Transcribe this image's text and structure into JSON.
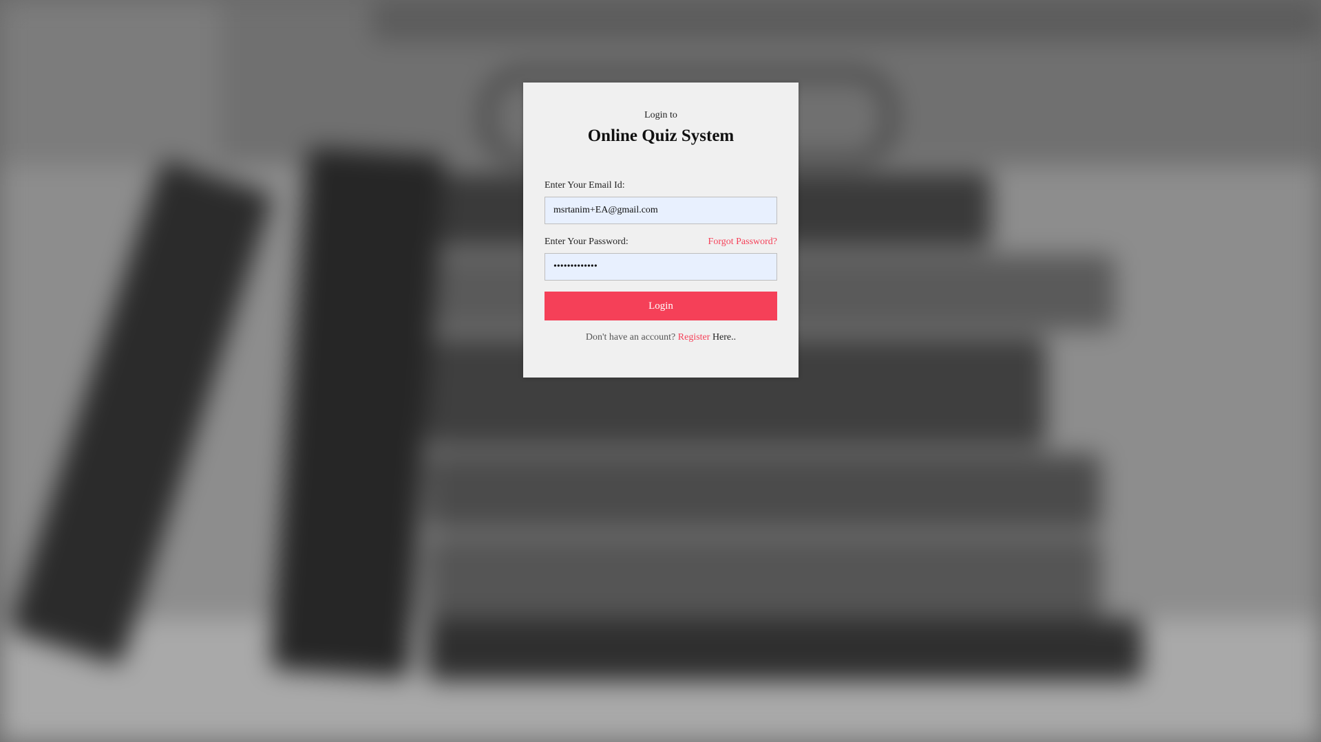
{
  "login": {
    "subtitle": "Login to",
    "title": "Online Quiz System",
    "email_label": "Enter Your Email Id:",
    "email_value": "msrtanim+EA@gmail.com",
    "password_label": "Enter Your Password:",
    "password_value": "•••••••••••••",
    "forgot_label": "Forgot Password?",
    "login_button": "Login",
    "no_account_text": "Don't have an account?",
    "register_link": "Register",
    "register_suffix": "Here.."
  },
  "colors": {
    "accent": "#f54058",
    "card_bg": "#f0f0f0",
    "input_bg": "#e8f0fe"
  }
}
